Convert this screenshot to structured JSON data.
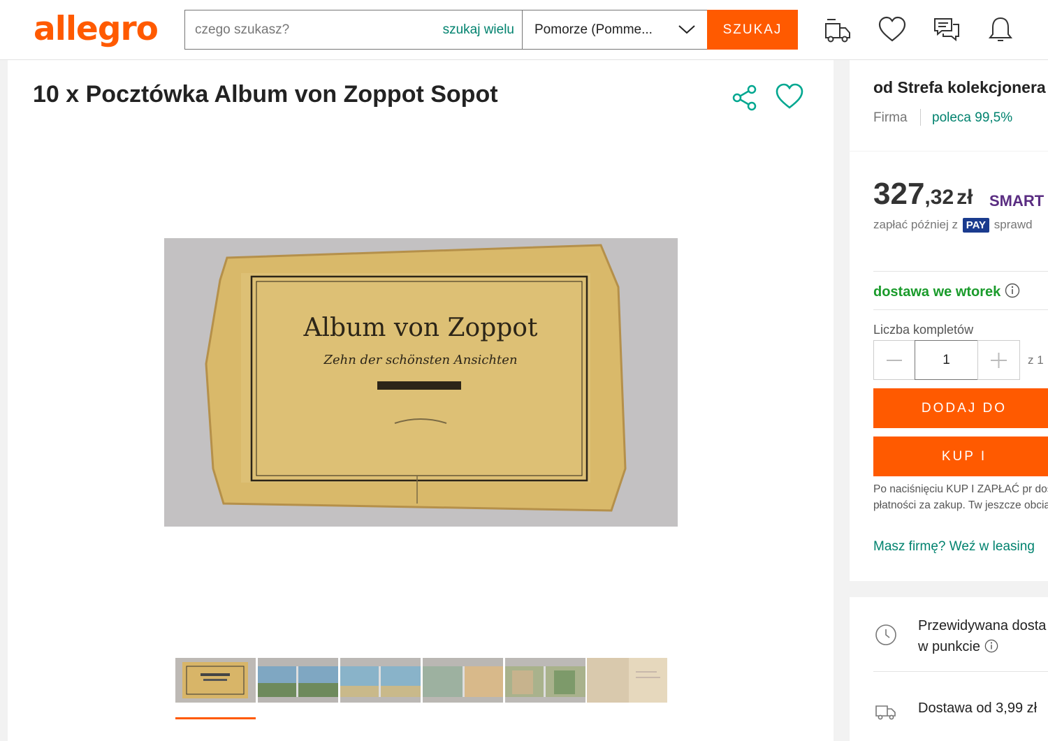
{
  "header": {
    "logo": "allegro",
    "search_placeholder": "czego szukasz?",
    "search_many": "szukaj wielu",
    "region": "Pomorze (Pomme...",
    "search_button": "SZUKAJ",
    "icons": [
      "delivery-truck-icon",
      "heart-icon",
      "chat-icon",
      "bell-icon"
    ]
  },
  "product": {
    "title": "10 x Pocztówka Album von Zoppot Sopot",
    "image_title": "Album von Zoppot",
    "image_subtitle": "Zehn der schönsten Ansichten",
    "thumbnail_count": 6,
    "active_thumbnail": 1
  },
  "seller": {
    "name": "od Strefa kolekcjonera",
    "type": "Firma",
    "rating": "poleca 99,5%"
  },
  "offer": {
    "price_int": "327",
    "price_dec": ",32",
    "currency": "zł",
    "smart": "SMART",
    "pay_later_prefix": "zapłać później z",
    "pay_badge": "PAY",
    "pay_later_suffix": "sprawd",
    "delivery_day": "dostawa we wtorek",
    "quantity_label": "Liczba kompletów",
    "quantity_value": "1",
    "quantity_of": "z 1",
    "add_to_cart": "DODAJ DO",
    "buy_now": "KUP I",
    "legal_text": "Po naciśnięciu KUP I ZAPŁAĆ pr dostawy i płatności za zakup. Tw jeszcze obciążone.",
    "leasing_link": "Masz firmę? Weź w leasing"
  },
  "delivery": {
    "pickup_line1": "Przewidywana dosta",
    "pickup_line2": "w punkcie",
    "delivery_from": "Dostawa od 3,99 zł"
  },
  "colors": {
    "brand": "#ff5a00",
    "link_green": "#00826e",
    "delivery_green": "#1a9b2b",
    "smart_purple": "#5a2d82"
  }
}
